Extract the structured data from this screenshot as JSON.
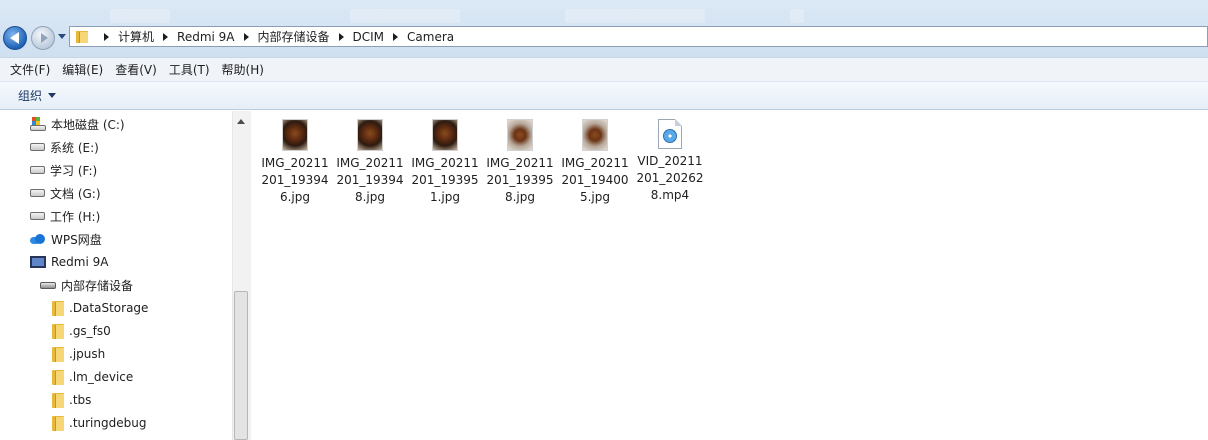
{
  "address_bar": {
    "breadcrumbs": [
      "计算机",
      "Redmi 9A",
      "内部存储设备",
      "DCIM",
      "Camera"
    ]
  },
  "menubar": {
    "items": [
      "文件(F)",
      "编辑(E)",
      "查看(V)",
      "工具(T)",
      "帮助(H)"
    ]
  },
  "toolbar": {
    "organize_label": "组织"
  },
  "nav": {
    "items": [
      {
        "label": "本地磁盘 (C:)",
        "icon": "system-drive-icon"
      },
      {
        "label": "系统 (E:)",
        "icon": "drive-icon"
      },
      {
        "label": "学习 (F:)",
        "icon": "drive-icon"
      },
      {
        "label": "文档 (G:)",
        "icon": "drive-icon"
      },
      {
        "label": "工作 (H:)",
        "icon": "drive-icon"
      },
      {
        "label": "WPS网盘",
        "icon": "cloud-icon"
      },
      {
        "label": "Redmi 9A",
        "icon": "phone-icon"
      },
      {
        "label": "内部存储设备",
        "icon": "storage-icon"
      },
      {
        "label": ".DataStorage",
        "icon": "folder-icon"
      },
      {
        "label": ".gs_fs0",
        "icon": "folder-icon"
      },
      {
        "label": ".jpush",
        "icon": "folder-icon"
      },
      {
        "label": ".lm_device",
        "icon": "folder-icon"
      },
      {
        "label": ".tbs",
        "icon": "folder-icon"
      },
      {
        "label": ".turingdebug",
        "icon": "folder-icon"
      }
    ]
  },
  "files": [
    {
      "name": "IMG_20211201_193946.jpg",
      "type": "image"
    },
    {
      "name": "IMG_20211201_193948.jpg",
      "type": "image"
    },
    {
      "name": "IMG_20211201_193951.jpg",
      "type": "image"
    },
    {
      "name": "IMG_20211201_193958.jpg",
      "type": "image"
    },
    {
      "name": "IMG_20211201_194005.jpg",
      "type": "image"
    },
    {
      "name": "VID_20211201_202628.mp4",
      "type": "video"
    }
  ]
}
